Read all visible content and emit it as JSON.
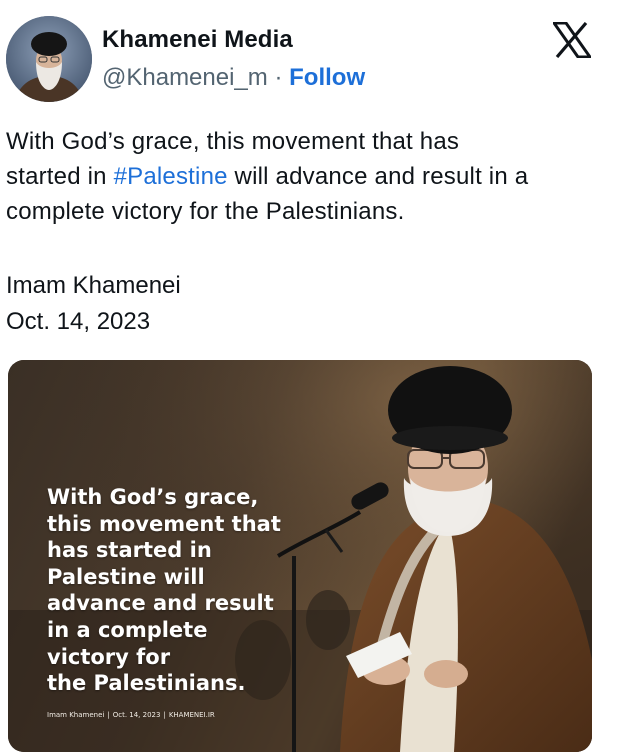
{
  "author": {
    "name": "Khamenei Media",
    "handle": "@Khamenei_m",
    "separator": "·",
    "follow_label": "Follow"
  },
  "icons": {
    "avatar": "profile-photo",
    "platform": "x-logo"
  },
  "colors": {
    "link": "#1d6fd8",
    "text": "#0f1419",
    "secondary_text": "#536471"
  },
  "tweet": {
    "line1": "With God’s grace, this movement that has",
    "line2_before": "started in ",
    "hashtag": "#Palestine",
    "line2_after": " will advance and result in a",
    "line3": "complete victory for the Palestinians.",
    "signature_name": "Imam Khamenei",
    "signature_date": "Oct. 14, 2023"
  },
  "media": {
    "quote_lines": [
      "With God’s grace,",
      "this movement that",
      "has started in",
      "Palestine will",
      "advance and result",
      "in a complete",
      "victory for",
      "the Palestinians."
    ],
    "caption_name": "Imam Khamenei",
    "caption_sep": "|",
    "caption_date": "Oct. 14, 2023",
    "caption_site": "KHAMENEI.IR"
  }
}
